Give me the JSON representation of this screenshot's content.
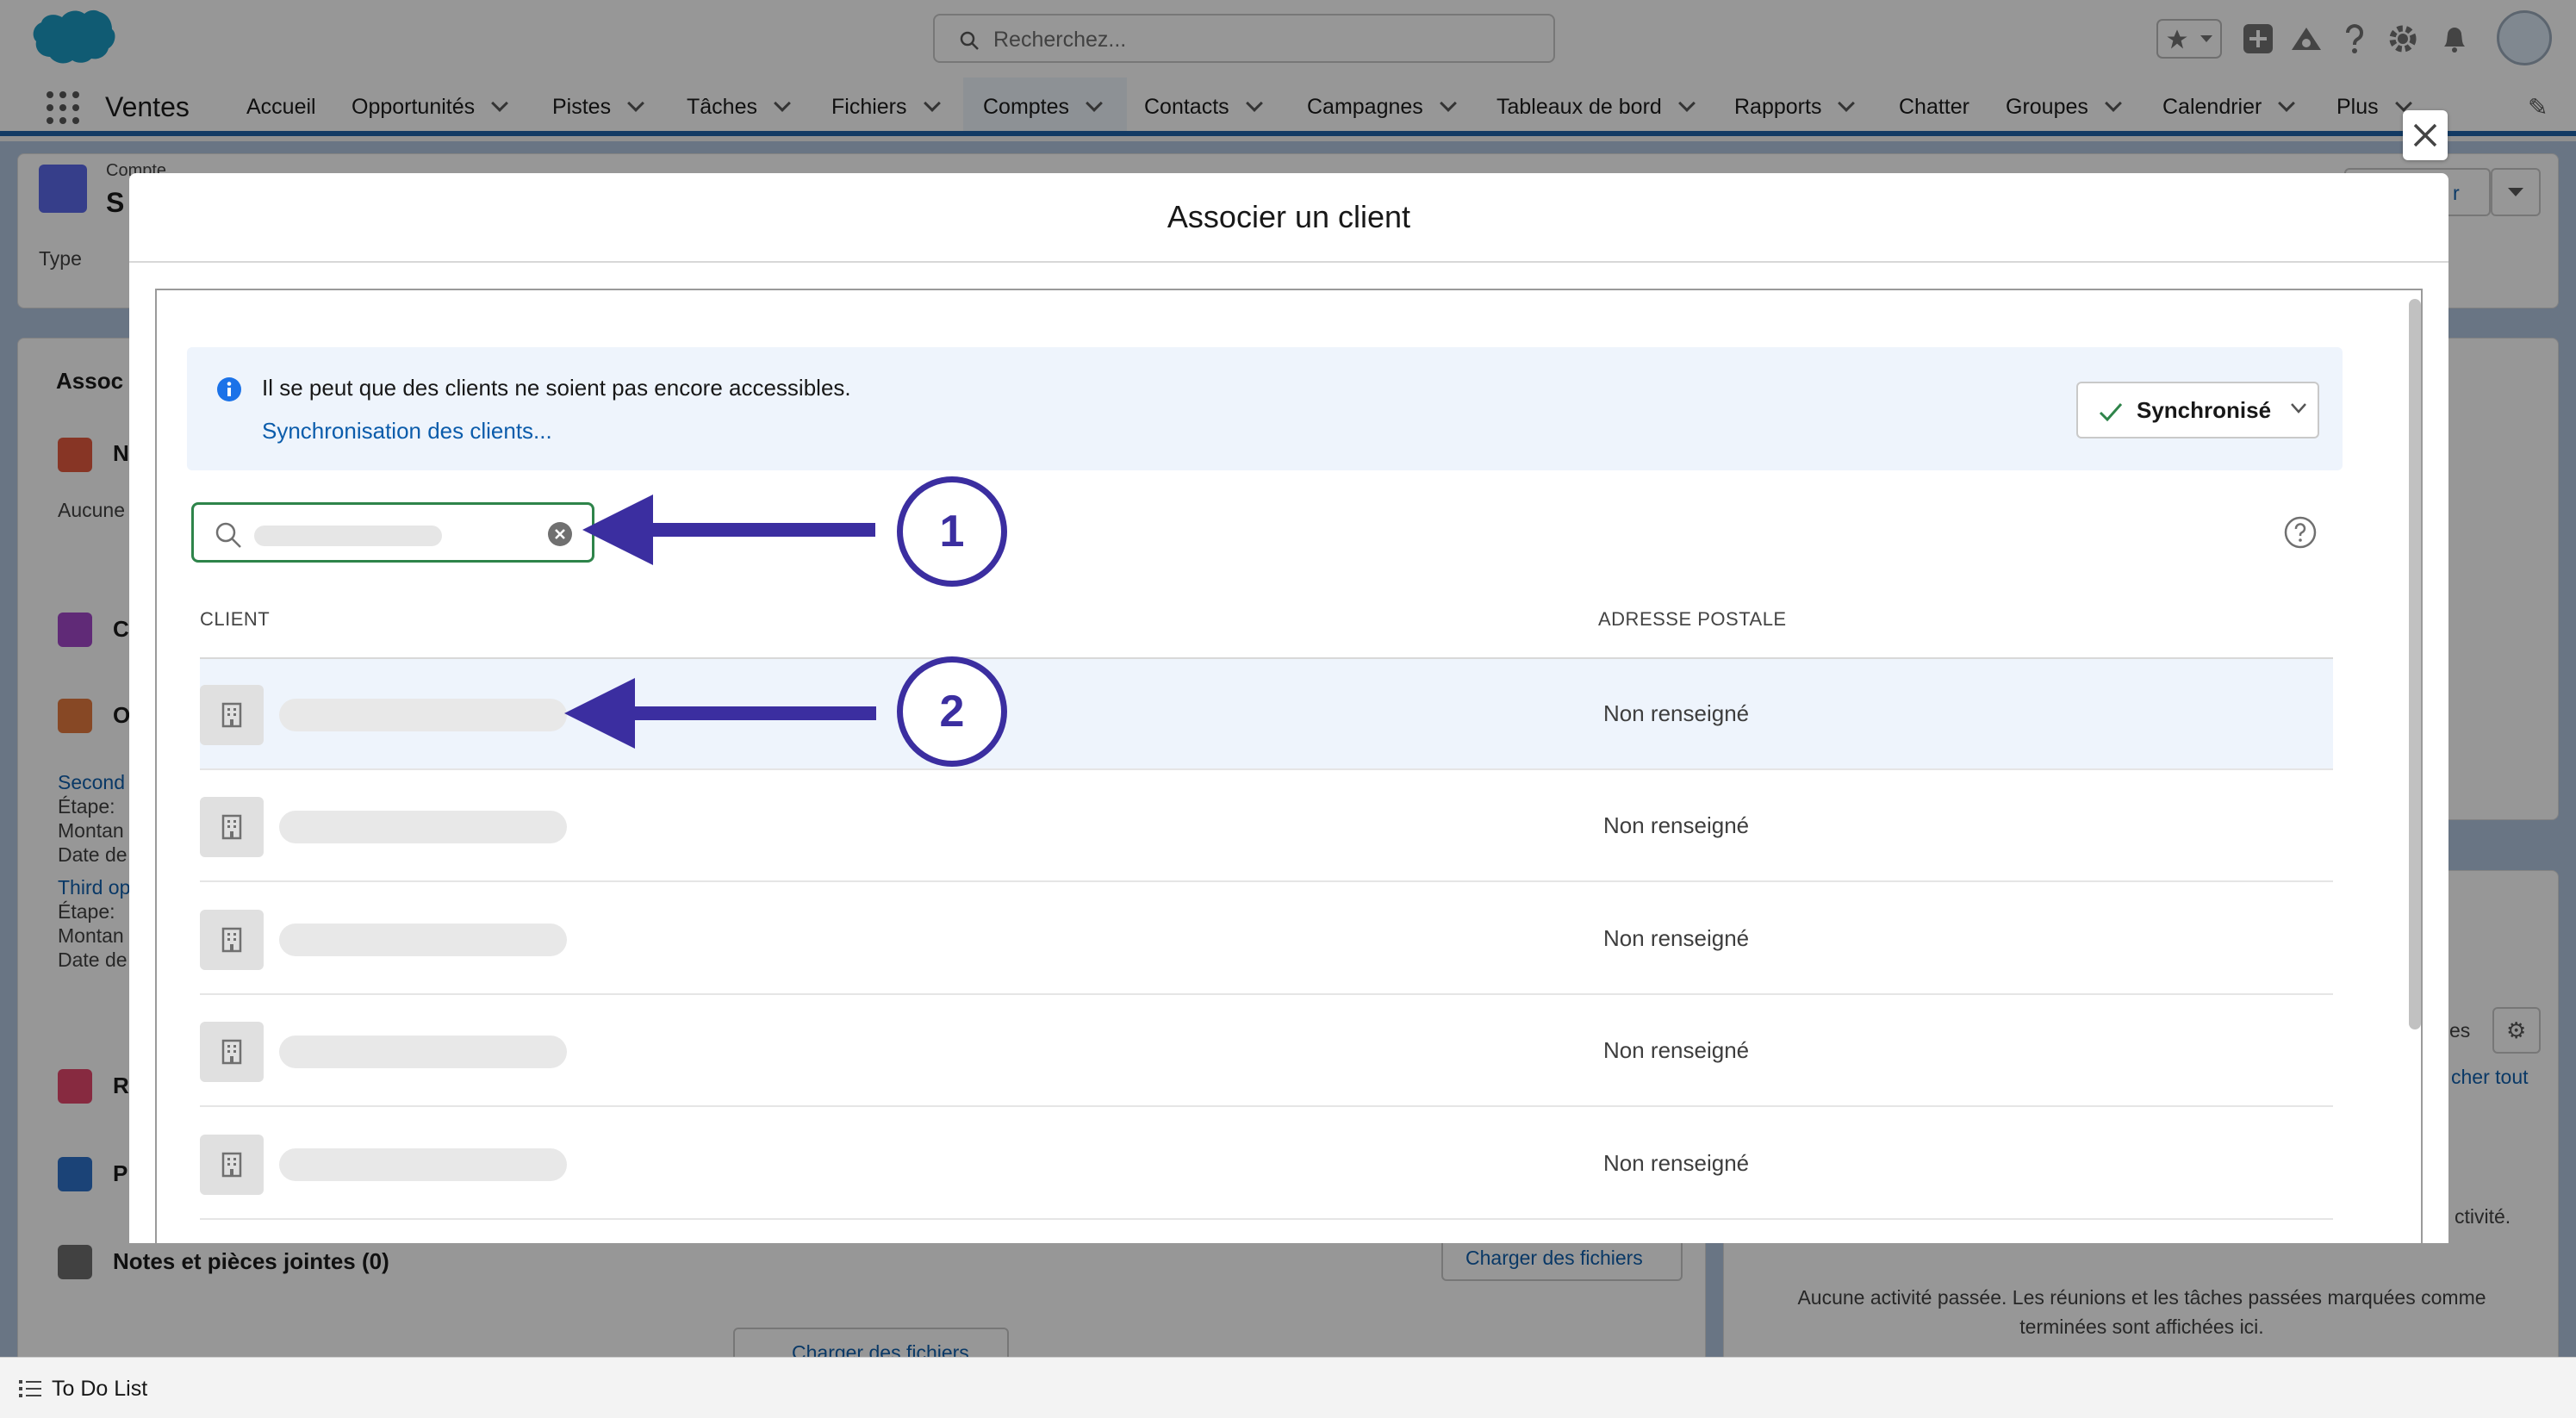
{
  "header": {
    "search_placeholder": "Recherchez..."
  },
  "nav": {
    "app_name": "Ventes",
    "tabs": [
      {
        "label": "Accueil"
      },
      {
        "label": "Opportunités"
      },
      {
        "label": "Pistes"
      },
      {
        "label": "Tâches"
      },
      {
        "label": "Fichiers"
      },
      {
        "label": "Comptes"
      },
      {
        "label": "Contacts"
      },
      {
        "label": "Campagnes"
      },
      {
        "label": "Tableaux de bord"
      },
      {
        "label": "Rapports"
      },
      {
        "label": "Chatter"
      },
      {
        "label": "Groupes"
      },
      {
        "label": "Calendrier"
      },
      {
        "label": "Plus"
      }
    ],
    "active_tab": "Comptes"
  },
  "background": {
    "record_label": "Compte",
    "record_name_initials": "S",
    "type_label": "Type",
    "assoc_tab": "Assoc",
    "card1_title": "N",
    "card1_text": "Aucune",
    "card2_title": "C",
    "card3_title": "O",
    "opp1_link": "Second",
    "opp1_stage": "Étape:",
    "opp1_amount": "Montan",
    "opp1_date": "Date de",
    "opp2_link": "Third op",
    "opp2_stage": "Étape:",
    "opp2_amount": "Montan",
    "opp2_date": "Date de",
    "card4_title": "R",
    "card5_title": "P",
    "notes_title": "Notes et pièces jointes (0)",
    "upload_button": "Charger des fichiers",
    "upload_button2": "Charger des fichiers",
    "right_text_es": "es",
    "right_link": "cher tout",
    "right_activity": "ctivité.",
    "activity_empty": "Aucune activité passée. Les réunions et les tâches passées marquées comme terminées sont affichées ici.",
    "header_btn_partial": "r"
  },
  "footer": {
    "todo_label": "To Do List"
  },
  "modal": {
    "title": "Associer un client",
    "info_text": "Il se peut que des clients ne soient pas encore accessibles.",
    "info_link": "Synchronisation des clients...",
    "sync_label": "Synchronisé",
    "columns": {
      "client": "CLIENT",
      "address": "ADRESSE POSTALE"
    },
    "rows": [
      {
        "address": "Non renseigné",
        "selected": true
      },
      {
        "address": "Non renseigné",
        "selected": false
      },
      {
        "address": "Non renseigné",
        "selected": false
      },
      {
        "address": "Non renseigné",
        "selected": false
      },
      {
        "address": "Non renseigné",
        "selected": false
      }
    ]
  },
  "annotations": {
    "badge1": "1",
    "badge2": "2",
    "color": "#3b2ea0"
  },
  "colors": {
    "brand_blue": "#1b5fa7",
    "link": "#0b5cab",
    "selected_row": "#eef4fc",
    "search_focus": "#2e844a"
  }
}
